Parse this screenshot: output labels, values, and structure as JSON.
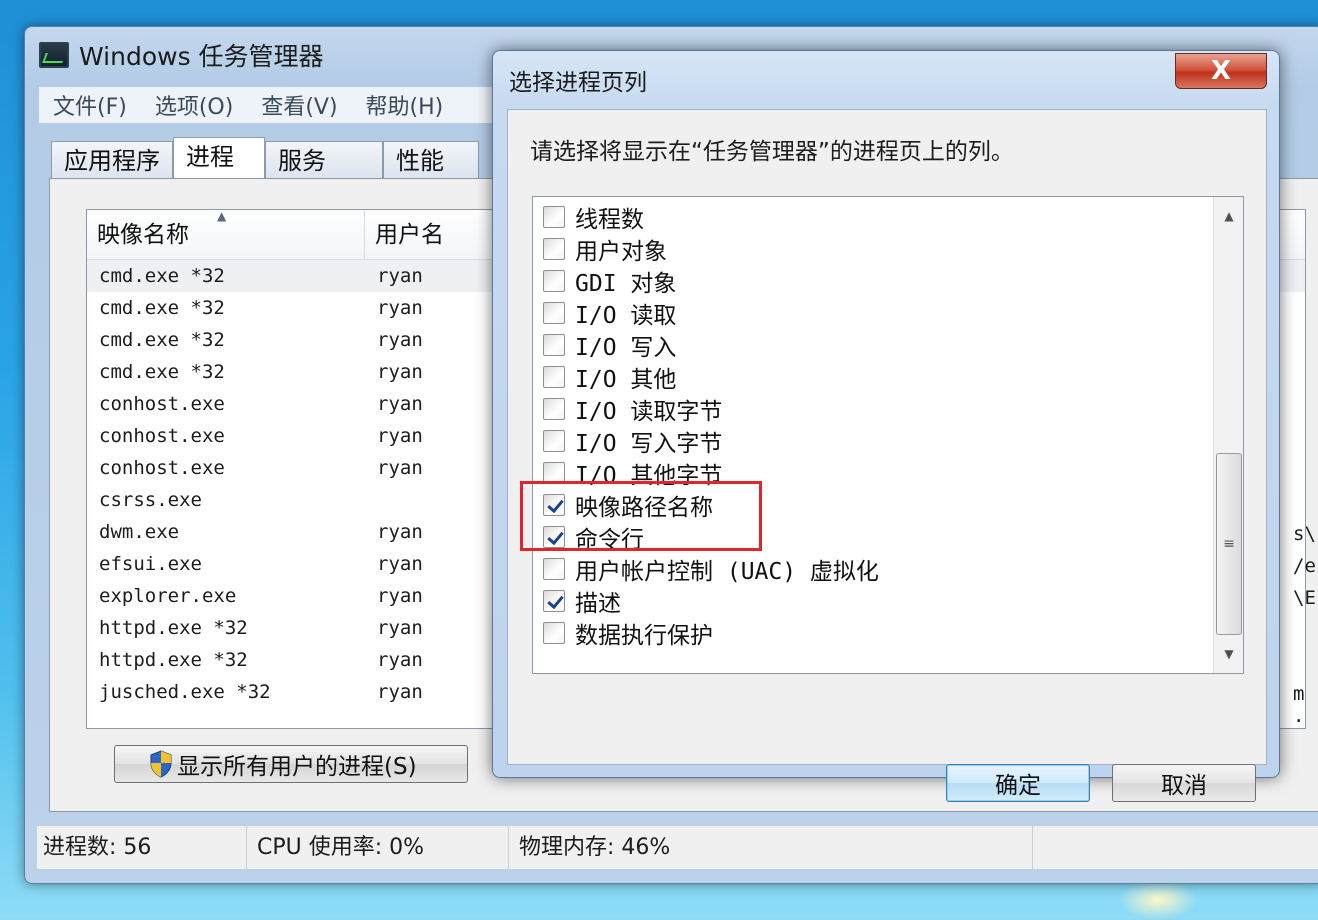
{
  "task_manager": {
    "title": "Windows 任务管理器",
    "menu": [
      "文件(F)",
      "选项(O)",
      "查看(V)",
      "帮助(H)"
    ],
    "tabs": [
      "应用程序",
      "进程",
      "服务",
      "性能"
    ],
    "active_tab": "进程",
    "columns": [
      "映像名称",
      "用户名"
    ],
    "sort_indicator": "▲",
    "processes": [
      {
        "name": "cmd.exe *32",
        "user": "ryan"
      },
      {
        "name": "cmd.exe *32",
        "user": "ryan"
      },
      {
        "name": "cmd.exe *32",
        "user": "ryan"
      },
      {
        "name": "cmd.exe *32",
        "user": "ryan"
      },
      {
        "name": "conhost.exe",
        "user": "ryan"
      },
      {
        "name": "conhost.exe",
        "user": "ryan"
      },
      {
        "name": "conhost.exe",
        "user": "ryan"
      },
      {
        "name": "csrss.exe",
        "user": ""
      },
      {
        "name": "dwm.exe",
        "user": "ryan"
      },
      {
        "name": "efsui.exe",
        "user": "ryan"
      },
      {
        "name": "explorer.exe",
        "user": "ryan"
      },
      {
        "name": "httpd.exe *32",
        "user": "ryan"
      },
      {
        "name": "httpd.exe *32",
        "user": "ryan"
      },
      {
        "name": "jusched.exe *32",
        "user": "ryan"
      }
    ],
    "right_fragments": [
      "s\\.",
      "/e.",
      "\\E.",
      "m ."
    ],
    "show_all_button": "显示所有用户的进程(S)",
    "status": {
      "processes": "进程数: 56",
      "cpu": "CPU 使用率: 0%",
      "memory": "物理内存: 46%"
    }
  },
  "dialog": {
    "title": "选择进程页列",
    "close_label": "X",
    "prompt": "请选择将显示在“任务管理器”的进程页上的列。",
    "columns": [
      {
        "label": "线程数",
        "checked": false
      },
      {
        "label": "用户对象",
        "checked": false
      },
      {
        "label": "GDI 对象",
        "checked": false
      },
      {
        "label": "I/O 读取",
        "checked": false
      },
      {
        "label": "I/O 写入",
        "checked": false
      },
      {
        "label": "I/O 其他",
        "checked": false
      },
      {
        "label": "I/O 读取字节",
        "checked": false
      },
      {
        "label": "I/O 写入字节",
        "checked": false
      },
      {
        "label": "I/O 其他字节",
        "checked": false
      },
      {
        "label": "映像路径名称",
        "checked": true
      },
      {
        "label": "命令行",
        "checked": true
      },
      {
        "label": "用户帐户控制 (UAC) 虚拟化",
        "checked": false
      },
      {
        "label": "描述",
        "checked": true
      },
      {
        "label": "数据执行保护",
        "checked": false
      }
    ],
    "scroll_up": "▲",
    "scroll_down": "▼",
    "scroll_grip": "≡",
    "ok_label": "确定",
    "cancel_label": "取消"
  }
}
